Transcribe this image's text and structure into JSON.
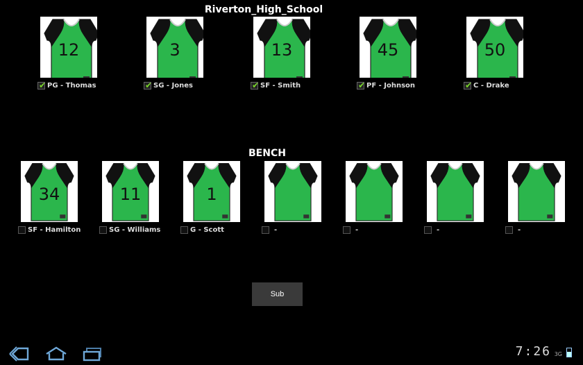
{
  "team_name": "Riverton_High_School",
  "bench_title": "BENCH",
  "starters": [
    {
      "number": "12",
      "label": "PG - Thomas",
      "checked": true
    },
    {
      "number": "3",
      "label": "SG - Jones",
      "checked": true
    },
    {
      "number": "13",
      "label": "SF - Smith",
      "checked": true
    },
    {
      "number": "45",
      "label": "PF - Johnson",
      "checked": true
    },
    {
      "number": "50",
      "label": "C - Drake",
      "checked": true
    }
  ],
  "bench": [
    {
      "number": "34",
      "label": "SF - Hamilton",
      "checked": false
    },
    {
      "number": "11",
      "label": "SG - Williams",
      "checked": false
    },
    {
      "number": "1",
      "label": "G - Scott",
      "checked": false
    },
    {
      "number": "",
      "label": "-",
      "checked": false
    },
    {
      "number": "",
      "label": "-",
      "checked": false
    },
    {
      "number": "",
      "label": "-",
      "checked": false
    },
    {
      "number": "",
      "label": "-",
      "checked": false
    }
  ],
  "sub_button_label": "Sub",
  "status_bar": {
    "time": "7:26",
    "signal": "3G",
    "battery_level": 0.6
  },
  "colors": {
    "jersey_green": "#2bb64c",
    "background": "#000000",
    "checkmark": "#7bd62c"
  },
  "nav_icons": [
    "back-icon",
    "home-icon",
    "recent-apps-icon"
  ]
}
